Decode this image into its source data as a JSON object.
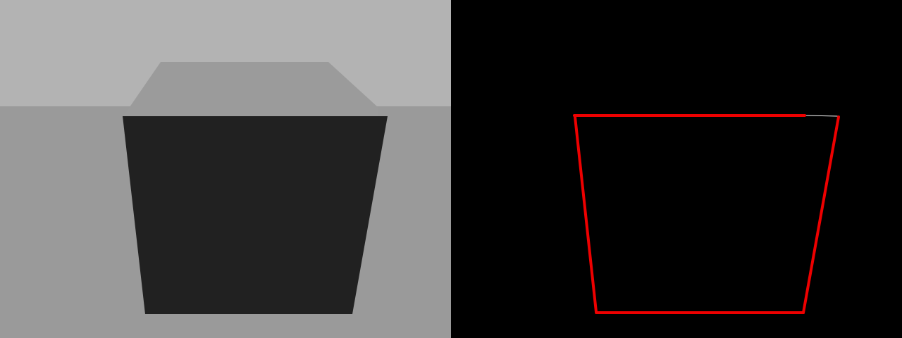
{
  "scene": {
    "colors": {
      "sky": "#b3b3b3",
      "ground": "#9a9a9a",
      "cube_top": "#9b9b9b",
      "cube_front": "#212121",
      "overlay_background": "#000000",
      "edge_highlight": "#ee0000",
      "edge_thin": "#ffffff"
    }
  }
}
